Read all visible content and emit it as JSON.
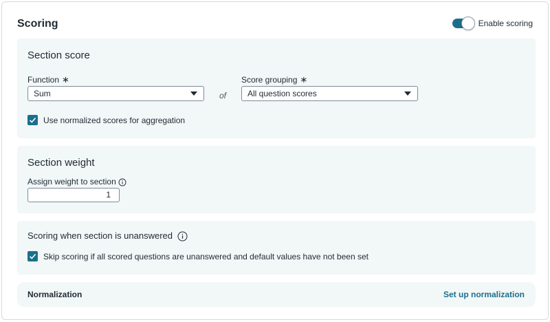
{
  "header": {
    "title": "Scoring",
    "toggle_label": "Enable scoring",
    "toggle_on": true
  },
  "section_score": {
    "heading": "Section score",
    "function_label": "Function",
    "function_value": "Sum",
    "of_text": "of",
    "grouping_label": "Score grouping",
    "grouping_value": "All question scores",
    "required_mark": "∗",
    "normalized_checkbox_label": "Use normalized scores for aggregation",
    "normalized_checked": true
  },
  "section_weight": {
    "heading": "Section weight",
    "assign_label": "Assign weight to section",
    "weight_value": "1"
  },
  "unanswered": {
    "heading": "Scoring when section is unanswered",
    "skip_checkbox_label": "Skip scoring if all scored questions are unanswered and default values have not been set",
    "skip_checked": true
  },
  "normalization": {
    "label": "Normalization",
    "link": "Set up normalization"
  },
  "colors": {
    "accent": "#1b6f8d",
    "panel_bg": "#f2f7f7",
    "text": "#1f2a33"
  }
}
